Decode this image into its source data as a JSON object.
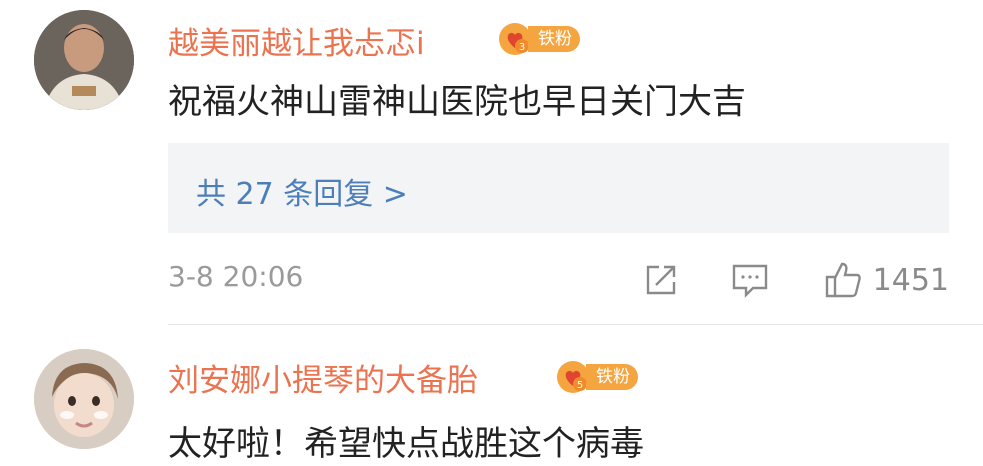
{
  "comments": [
    {
      "username": "越美丽越让我忐忑i",
      "badge": {
        "level": "3",
        "label": "铁粉"
      },
      "text": "祝福火神山雷神山医院也早日关门大吉",
      "replies_label": "共 27 条回复 >",
      "timestamp": "3-8 20:06",
      "likes": "1451"
    },
    {
      "username": "刘安娜小提琴的大备胎",
      "badge": {
        "level": "5",
        "label": "铁粉"
      },
      "text": "太好啦！希望快点战胜这个病毒"
    }
  ],
  "colors": {
    "username": "#eb7350",
    "link": "#4c7fb8",
    "badge": "#f5a53f"
  },
  "icons": [
    "share-icon",
    "comment-icon",
    "like-icon",
    "fan-badge-icon"
  ]
}
